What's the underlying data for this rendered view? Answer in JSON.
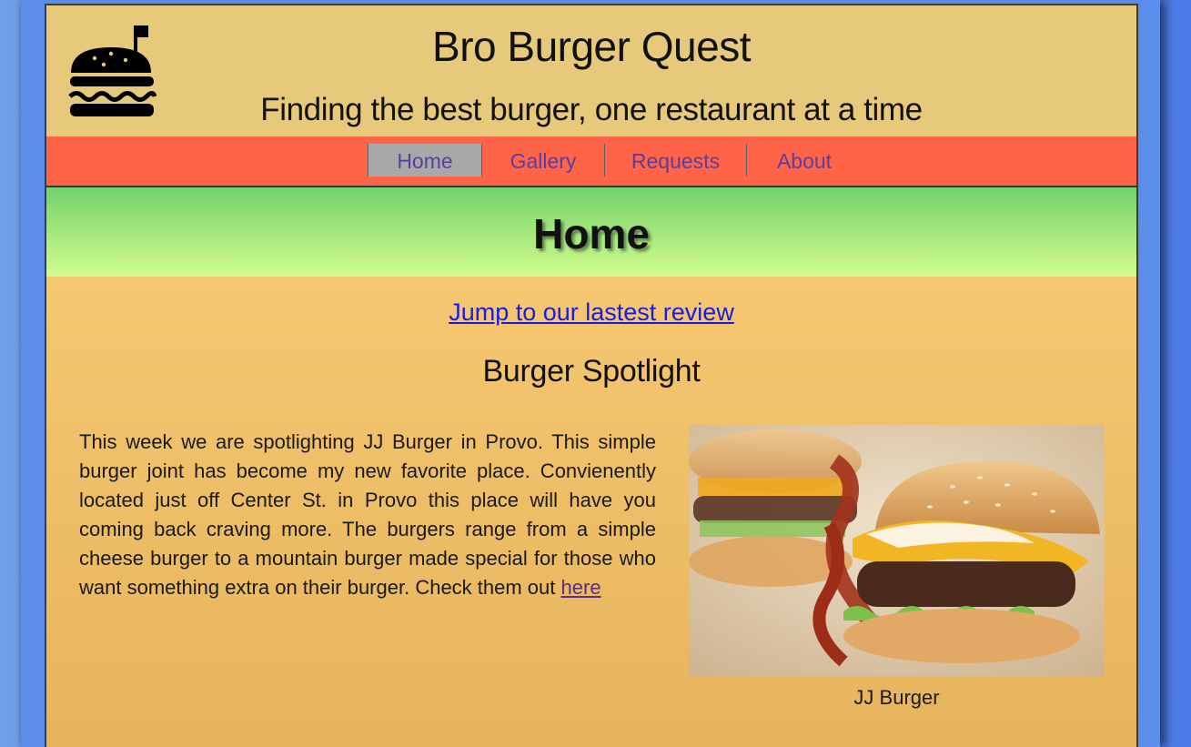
{
  "header": {
    "logo_icon": "burger-flag-icon",
    "title": "Bro Burger Quest",
    "tagline": "Finding the best burger, one restaurant at a time"
  },
  "nav": {
    "items": [
      {
        "label": "Home",
        "active": true
      },
      {
        "label": "Gallery",
        "active": false
      },
      {
        "label": "Requests",
        "active": false
      },
      {
        "label": "About",
        "active": false
      }
    ]
  },
  "hero": {
    "title": "Home"
  },
  "main": {
    "jump_link": "Jump to our lastest review",
    "spotlight_heading": "Burger Spotlight",
    "spotlight_text": "This week we are spotlighting JJ Burger in Provo. This simple burger joint has become my new favorite place. Convienently located just off Center St. in Provo this place will have you coming back craving more. The burgers range from a simple cheese burger to a mountain burger made special for those who want something extra on their burger. Check them out",
    "spotlight_link": "here",
    "image_caption": "JJ Burger"
  },
  "colors": {
    "header_bg": "#e6c97a",
    "nav_bg": "#ff6448",
    "nav_active_bg": "#a8a8a8",
    "nav_text": "#5a3e9c",
    "hero_gradient_top": "#72d26c",
    "hero_gradient_bottom": "#d2fb8e",
    "content_bg": "#f3c56e",
    "link": "#1a1ae6",
    "visited_link": "#5a2e83",
    "page_frame": "#5b8eea"
  }
}
